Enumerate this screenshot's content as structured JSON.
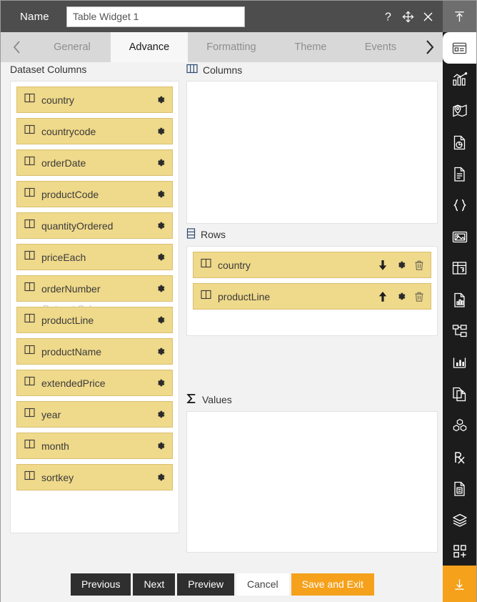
{
  "header": {
    "name_label": "Name",
    "name_value": "Table Widget 1",
    "name_placeholder": "Name",
    "icons": [
      "help-icon",
      "move-icon",
      "close-icon"
    ]
  },
  "tabs": {
    "prev_arrow": "chevron-left-icon",
    "next_arrow": "chevron-right-icon",
    "items": [
      {
        "label": "General",
        "active": false
      },
      {
        "label": "Advance",
        "active": true
      },
      {
        "label": "Formatting",
        "active": false
      },
      {
        "label": "Theme",
        "active": false
      },
      {
        "label": "Events",
        "active": false
      }
    ]
  },
  "dataset_panel": {
    "title": "Dataset Columns",
    "ghost_text": "Dataset Column",
    "columns": [
      {
        "name": "country"
      },
      {
        "name": "countrycode"
      },
      {
        "name": "orderDate"
      },
      {
        "name": "productCode"
      },
      {
        "name": "quantityOrdered"
      },
      {
        "name": "priceEach"
      },
      {
        "name": "orderNumber"
      },
      {
        "name": "productLine"
      },
      {
        "name": "productName"
      },
      {
        "name": "extendedPrice"
      },
      {
        "name": "year"
      },
      {
        "name": "month"
      },
      {
        "name": "sortkey"
      }
    ]
  },
  "columns_panel": {
    "title": "Columns",
    "icon": "columns-icon",
    "items": []
  },
  "rows_panel": {
    "title": "Rows",
    "icon": "rows-icon",
    "items": [
      {
        "name": "country",
        "sort": "descending",
        "sort_icon": "arrow-down-icon"
      },
      {
        "name": "productLine",
        "sort": "ascending",
        "sort_icon": "arrow-up-icon"
      }
    ]
  },
  "values_panel": {
    "title": "Values",
    "icon": "sigma-icon",
    "items": []
  },
  "footer": {
    "previous": "Previous",
    "next": "Next",
    "preview": "Preview",
    "cancel": "Cancel",
    "save_and_exit": "Save and Exit"
  },
  "rail": {
    "top_icon": "upload-icon",
    "items": [
      "widget-card-icon",
      "bar-chart-icon",
      "map-pin-icon",
      "pie-report-icon",
      "document-icon",
      "code-braces-icon",
      "image-icon",
      "table-icon",
      "chart-panel-icon",
      "file-text-icon",
      "hierarchy-icon",
      "line-chart-icon",
      "copy-page-icon",
      "cubes-icon",
      "prescription-icon",
      "note-icon",
      "layers-icon",
      "add-widget-icon"
    ],
    "bottom_icon": "download-icon"
  },
  "colors": {
    "header_bg": "#4d4d4d",
    "chip_bg": "#efd98a",
    "chip_border": "#d9c071",
    "accent": "#f5a11b",
    "rail_bg": "#1c1c1c",
    "tab_bg": "#d8d8d8"
  }
}
